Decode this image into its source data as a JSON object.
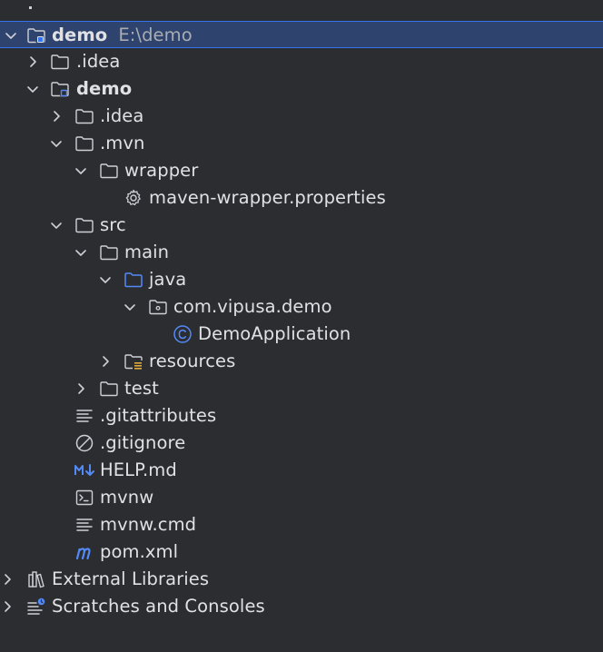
{
  "tree": {
    "root": {
      "name": "demo",
      "path": "E:\\demo"
    },
    "idea_top": ".idea",
    "module": "demo",
    "idea_inner": ".idea",
    "mvn": ".mvn",
    "wrapper": "wrapper",
    "wrapper_props": "maven-wrapper.properties",
    "src": "src",
    "main": "main",
    "java": "java",
    "package": "com.vipusa.demo",
    "app_class": "DemoApplication",
    "resources": "resources",
    "test": "test",
    "gitattributes": ".gitattributes",
    "gitignore": ".gitignore",
    "help": "HELP.md",
    "mvnw": "mvnw",
    "mvnw_cmd": "mvnw.cmd",
    "pom": "pom.xml",
    "external_libraries": "External Libraries",
    "scratches": "Scratches and Consoles"
  },
  "icons": {
    "folder_color": "#ced0d6",
    "source_folder_color": "#548af7",
    "class_color": "#548af7",
    "markdown_color": "#548af7",
    "maven_color": "#548af7"
  }
}
